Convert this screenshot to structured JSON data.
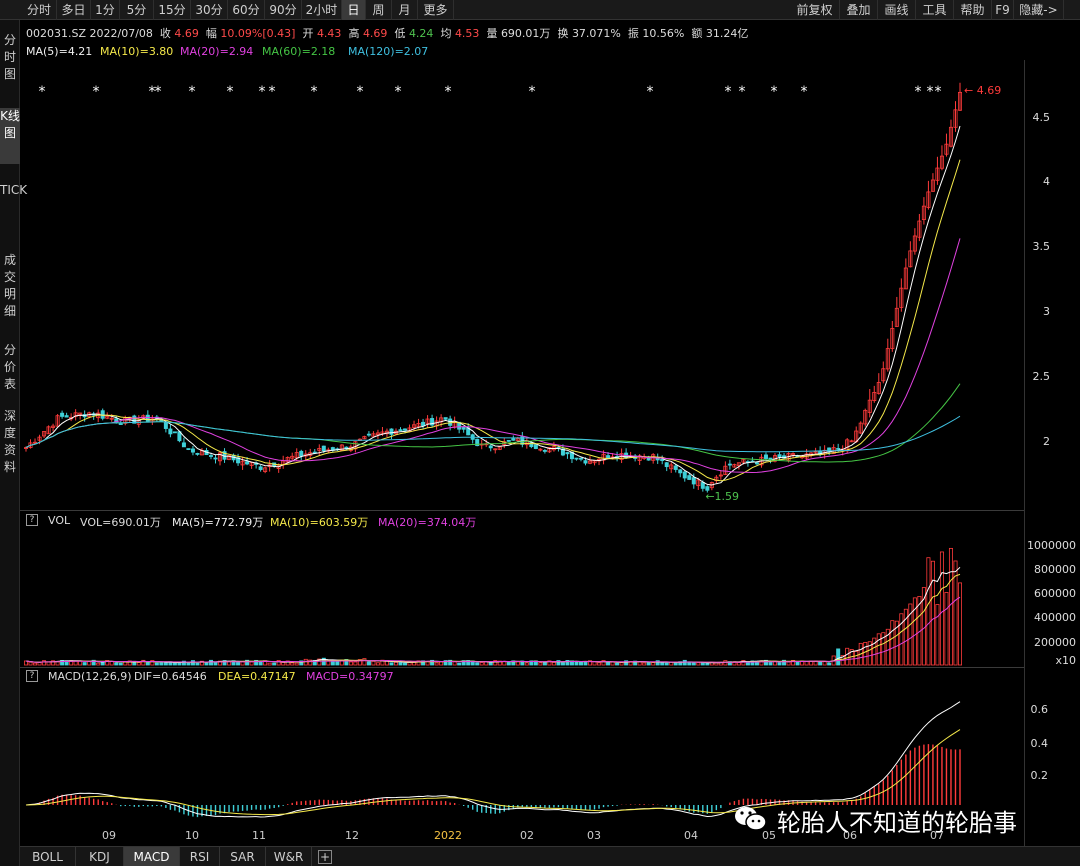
{
  "toolbar": {
    "tabs": [
      "分时",
      "多日",
      "1分",
      "5分",
      "15分",
      "30分",
      "60分",
      "90分",
      "2小时",
      "日",
      "周",
      "月",
      "更多"
    ],
    "active_tab": "日",
    "right_tabs": [
      "前复权",
      "叠加",
      "画线",
      "工具",
      "帮助",
      "F9",
      "隐藏->"
    ]
  },
  "sidebar": {
    "items": [
      "分时图",
      "K线图",
      "TICK",
      "成交明细",
      "分价表",
      "深度资料"
    ],
    "active_item": "K线图"
  },
  "quote": {
    "code_date": "002031.SZ 2022/07/08",
    "close_label": "收",
    "close": "4.69",
    "range_label": "幅",
    "range": "10.09%[0.43]",
    "open_label": "开",
    "open": "4.43",
    "high_label": "高",
    "high": "4.69",
    "low_label": "低",
    "low": "4.24",
    "avg_label": "均",
    "avg": "4.53",
    "vol_label": "量",
    "vol": "690.01万",
    "turnover_label": "换",
    "turnover": "37.071%",
    "amplitude_label": "振",
    "amplitude": "10.56%",
    "amount_label": "额",
    "amount": "31.24亿"
  },
  "ma_legend": {
    "ma5": "MA(5)=4.21",
    "ma10": "MA(10)=3.80",
    "ma20": "MA(20)=2.94",
    "ma60": "MA(60)=2.18",
    "ma120": "MA(120)=2.07"
  },
  "price_axis": [
    "4.5",
    "4",
    "3.5",
    "3",
    "2.5",
    "2"
  ],
  "markers": {
    "high_label": "4.69",
    "low_label": "1.59",
    "star": "*"
  },
  "vol_legend": {
    "help": "?",
    "name": "VOL",
    "vol": "VOL=690.01万",
    "ma5": "MA(5)=772.79万",
    "ma10": "MA(10)=603.59万",
    "ma20": "MA(20)=374.04万"
  },
  "vol_axis": [
    "1000000",
    "800000",
    "600000",
    "400000",
    "200000"
  ],
  "vol_unit": "x10",
  "macd_legend": {
    "help": "?",
    "name": "MACD(12,26,9)",
    "dif": "DIF=0.64546",
    "dea": "DEA=0.47147",
    "macd": "MACD=0.34797"
  },
  "macd_axis": [
    "0.6",
    "0.4",
    "0.2"
  ],
  "months": [
    "09",
    "10",
    "11",
    "12",
    "2022",
    "02",
    "03",
    "04",
    "05",
    "06",
    "07"
  ],
  "bottom_tabs": [
    "BOLL",
    "KDJ",
    "MACD",
    "RSI",
    "SAR",
    "W&R",
    "+"
  ],
  "active_bottom_tab": "MACD",
  "watermark": "轮胎人不知道的轮胎事",
  "colors": {
    "up": "#ff3b3b",
    "down": "#3fd0d8",
    "ma5": "#ffffff",
    "ma10": "#f5e94a",
    "ma20": "#e041e0",
    "ma60": "#45c545",
    "ma120": "#3fc0e0"
  },
  "chart_data": {
    "type": "candlestick",
    "price_range": [
      1.5,
      4.8
    ],
    "anchors": {
      "low": 1.59,
      "last_close": 4.69
    },
    "series_summary": [
      {
        "name": "MA(5)",
        "last": 4.21
      },
      {
        "name": "MA(10)",
        "last": 3.8
      },
      {
        "name": "MA(20)",
        "last": 2.94
      },
      {
        "name": "MA(60)",
        "last": 2.18
      },
      {
        "name": "MA(120)",
        "last": 2.07
      }
    ]
  }
}
